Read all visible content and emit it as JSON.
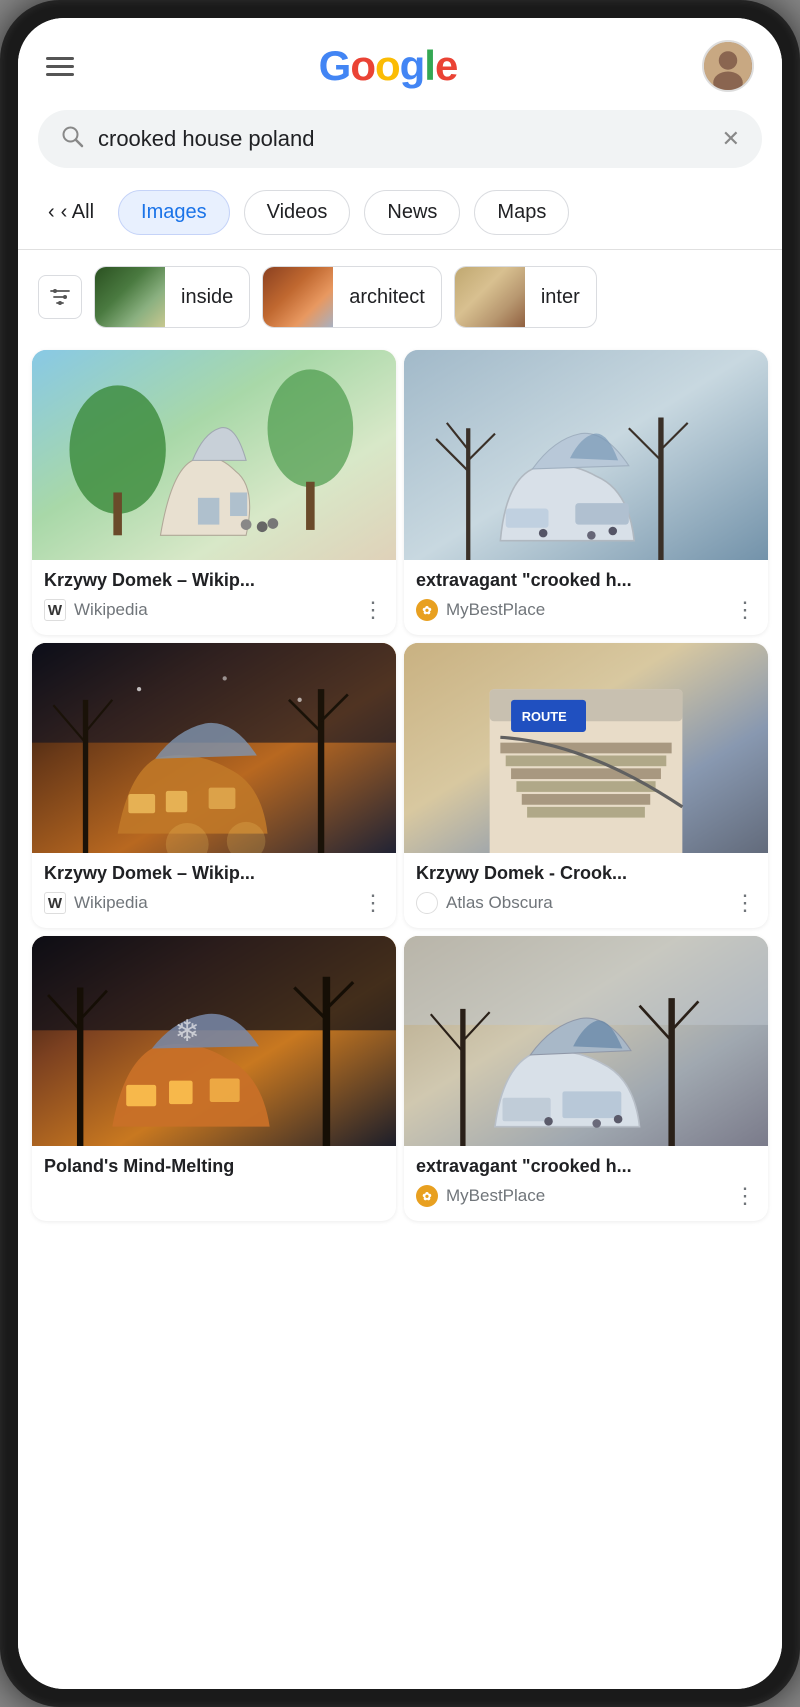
{
  "phone": {
    "header": {
      "menu_label": "Menu",
      "logo": {
        "G": "G",
        "o1": "o",
        "o2": "o",
        "g": "g",
        "l": "l",
        "e": "e"
      }
    },
    "search": {
      "query": "crooked house poland",
      "placeholder": "Search"
    },
    "filter_tabs": {
      "back_label": "‹ All",
      "tabs": [
        {
          "id": "images",
          "label": "Images",
          "active": true
        },
        {
          "id": "videos",
          "label": "Videos",
          "active": false
        },
        {
          "id": "news",
          "label": "News",
          "active": false
        },
        {
          "id": "maps",
          "label": "Maps",
          "active": false
        }
      ]
    },
    "image_chips": {
      "filter_icon_label": "Filter",
      "chips": [
        {
          "id": "inside",
          "label": "inside"
        },
        {
          "id": "architect",
          "label": "architect"
        },
        {
          "id": "interior",
          "label": "inter"
        }
      ]
    },
    "image_results": [
      {
        "id": "result-1",
        "title": "Krzywy Domek – Wikip...",
        "source": "Wikipedia",
        "source_type": "wikipedia",
        "img_class": "img-1"
      },
      {
        "id": "result-2",
        "title": "extravagant \"crooked h...",
        "source": "MyBestPlace",
        "source_type": "mybestplace",
        "img_class": "img-2"
      },
      {
        "id": "result-3",
        "title": "Krzywy Domek – Wikip...",
        "source": "Wikipedia",
        "source_type": "wikipedia",
        "img_class": "img-3"
      },
      {
        "id": "result-4",
        "title": "Krzywy Domek - Crook...",
        "source": "Atlas Obscura",
        "source_type": "atlas",
        "img_class": "img-4"
      },
      {
        "id": "result-5",
        "title": "Poland's Mind-Melting",
        "source": "",
        "source_type": "",
        "img_class": "img-5"
      },
      {
        "id": "result-6",
        "title": "extravagant \"crooked h...",
        "source": "MyBestPlace",
        "source_type": "mybestplace",
        "img_class": "img-6"
      }
    ]
  }
}
